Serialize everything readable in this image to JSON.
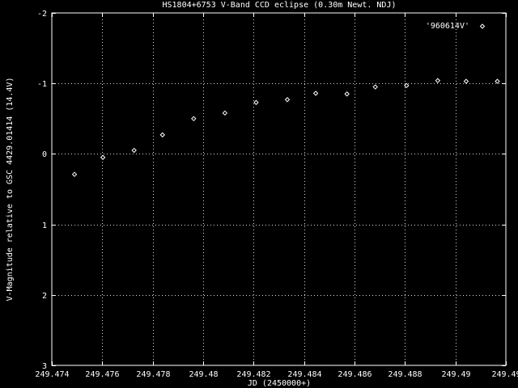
{
  "chart_data": {
    "type": "scatter",
    "title": "HS1804+6753 V-Band CCD eclipse (0.30m Newt. NDJ)",
    "xlabel": "JD (2450000+)",
    "ylabel": "V-Magnitude relative to GSC 4429.01414 (14.4V)",
    "xlim": [
      249.474,
      249.49
    ],
    "ylim": [
      3,
      -2
    ],
    "y_inverted": true,
    "grid": true,
    "legend_position": "top-right",
    "x_ticks": [
      249.474,
      249.476,
      249.478,
      249.48,
      249.482,
      249.484,
      249.486,
      249.488,
      249.49,
      249.49
    ],
    "x_tick_labels": [
      "249.474",
      "249.476",
      "249.478",
      "249.48",
      "249.482",
      "249.484",
      "249.486",
      "249.488",
      "249.49",
      "249.49"
    ],
    "y_ticks": [
      -2,
      -1,
      0,
      1,
      2,
      3
    ],
    "y_tick_labels": [
      "-2",
      "-1",
      "0",
      "1",
      "2",
      "3"
    ],
    "series": [
      {
        "name": "'960614V'",
        "color": "#ffffff",
        "marker": "diamond",
        "points": [
          {
            "x": 249.4748,
            "y": 0.29
          },
          {
            "x": 249.4758,
            "y": 0.05
          },
          {
            "x": 249.4769,
            "y": -0.05
          },
          {
            "x": 249.4779,
            "y": -0.27
          },
          {
            "x": 249.479,
            "y": -0.5
          },
          {
            "x": 249.4801,
            "y": -0.58
          },
          {
            "x": 249.4812,
            "y": -0.73
          },
          {
            "x": 249.4823,
            "y": -0.77
          },
          {
            "x": 249.4833,
            "y": -0.86
          },
          {
            "x": 249.4844,
            "y": -0.85
          },
          {
            "x": 249.4854,
            "y": -0.95
          },
          {
            "x": 249.4865,
            "y": -0.97
          },
          {
            "x": 249.4876,
            "y": -1.04
          },
          {
            "x": 249.4886,
            "y": -1.03
          },
          {
            "x": 249.4897,
            "y": -1.03
          },
          {
            "x": 249.4908,
            "y": -1.09
          }
        ]
      }
    ]
  }
}
